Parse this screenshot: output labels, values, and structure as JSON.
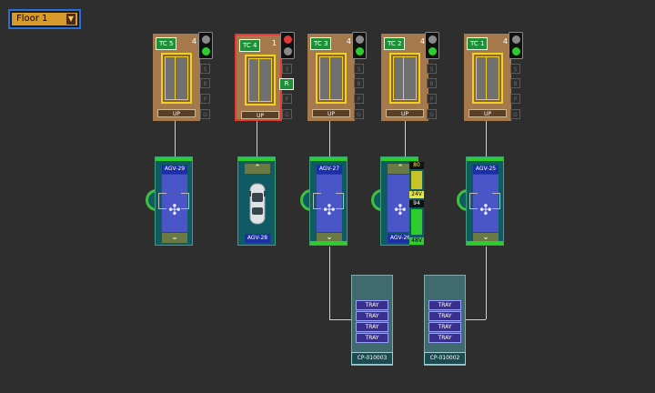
{
  "floor_select": {
    "value": "Floor 1"
  },
  "tcs": [
    {
      "tag": "TC 5",
      "count": "4",
      "up": "UP",
      "light": [
        "gray",
        "green"
      ],
      "side": [
        "S",
        "B",
        "P",
        "G"
      ],
      "selected": false
    },
    {
      "tag": "TC 4",
      "count": "1",
      "up": "UP",
      "light": [
        "red",
        "gray"
      ],
      "side": [
        "S",
        "R",
        "P",
        "G"
      ],
      "selected": true
    },
    {
      "tag": "TC 3",
      "count": "4",
      "up": "UP",
      "light": [
        "gray",
        "green"
      ],
      "side": [
        "S",
        "B",
        "P",
        "G"
      ],
      "selected": false
    },
    {
      "tag": "TC 2",
      "count": "4",
      "up": "UP",
      "light": [
        "gray",
        "green"
      ],
      "side": [
        "S",
        "B",
        "P",
        "G"
      ],
      "selected": false
    },
    {
      "tag": "TC 1",
      "count": "4",
      "up": "UP",
      "light": [
        "gray",
        "green"
      ],
      "side": [
        "S",
        "B",
        "P",
        "G"
      ],
      "selected": false
    }
  ],
  "agvs": [
    {
      "label": "AGV-29"
    },
    {
      "label": "AGV-28"
    },
    {
      "label": "AGV-27"
    },
    {
      "label": "AGV-26",
      "battery": {
        "top": "80",
        "v1": "24V",
        "mid": "94",
        "v2": "48V"
      }
    },
    {
      "label": "AGV-25"
    }
  ],
  "stacks": [
    {
      "label": "CP-010003",
      "trays": [
        "TRAY",
        "TRAY",
        "TRAY",
        "TRAY"
      ]
    },
    {
      "label": "CP-010002",
      "trays": [
        "TRAY",
        "TRAY",
        "TRAY",
        "TRAY"
      ]
    }
  ],
  "colors": {
    "green": "#2ecc2e",
    "red": "#e53935",
    "gray": "#8a8a8a"
  }
}
